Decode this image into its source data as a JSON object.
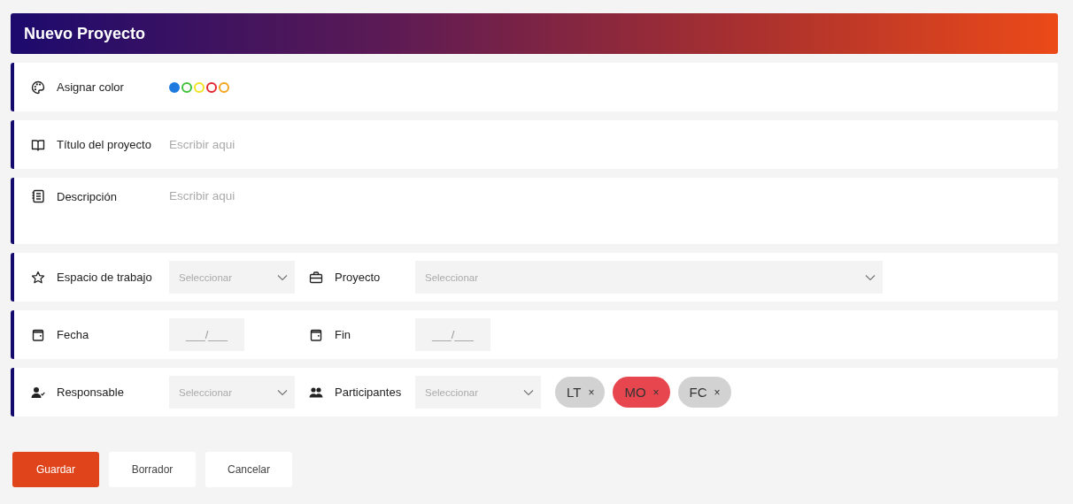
{
  "header": {
    "title": "Nuevo Proyecto"
  },
  "rows": [
    {
      "kind": "color",
      "fields": [
        {
          "label": "Asignar color",
          "swatches": [
            {
              "color": "#1f7ae0",
              "selected": true
            },
            {
              "color": "#3fc23a",
              "selected": false
            },
            {
              "color": "#f2e21c",
              "selected": false
            },
            {
              "color": "#e2262f",
              "selected": false
            },
            {
              "color": "#f2a51c",
              "selected": false
            }
          ]
        }
      ]
    },
    {
      "kind": "text",
      "fields": [
        {
          "label": "Título del proyecto",
          "placeholder": "Escribir aqui"
        }
      ]
    },
    {
      "kind": "textarea",
      "fields": [
        {
          "label": "Descripción",
          "placeholder": "Escribir aqui"
        }
      ]
    },
    {
      "kind": "select",
      "fields": [
        {
          "label": "Espacio de trabajo",
          "placeholder": "Seleccionar"
        },
        {
          "label": "Proyecto",
          "placeholder": "Seleccionar",
          "wide": true
        }
      ]
    },
    {
      "kind": "date",
      "fields": [
        {
          "label": "Fecha",
          "placeholder": "___/___"
        },
        {
          "label": "Fin",
          "placeholder": "___/___"
        }
      ]
    },
    {
      "kind": "select",
      "fields": [
        {
          "label": "Responsable",
          "placeholder": "Seleccionar"
        },
        {
          "label": "Participantes",
          "placeholder": "Seleccionar",
          "chips": [
            {
              "text": "LT",
              "remove": "×",
              "color": "#d2d2d2"
            },
            {
              "text": "MO",
              "remove": "×",
              "color": "#e8464f"
            },
            {
              "text": "FC",
              "remove": "×",
              "color": "#d2d2d2"
            }
          ]
        }
      ]
    }
  ],
  "buttons": [
    {
      "label": "Guardar",
      "kind": "primary"
    },
    {
      "label": "Borrador",
      "kind": "secondary"
    },
    {
      "label": "Cancelar",
      "kind": "secondary"
    }
  ]
}
